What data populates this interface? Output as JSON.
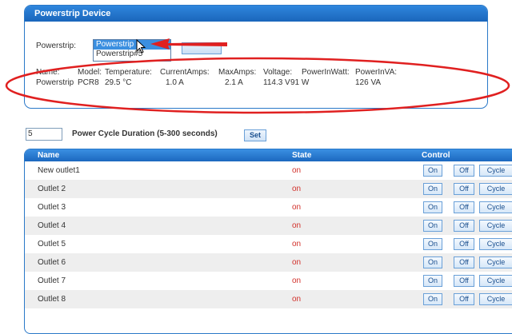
{
  "device_panel": {
    "title": "Powerstrip Device",
    "powerstrip_label": "Powerstrip:",
    "options": [
      "Powerstrip",
      "Powerstrip#5"
    ],
    "selected_option": "Powerstrip",
    "button_label": "",
    "info": {
      "headers": [
        "Name:",
        "Model:",
        "Temperature:",
        "CurrentAmps:",
        "MaxAmps:",
        "Voltage:",
        "PowerInWatt:",
        "PowerInVA:"
      ],
      "values": [
        "Powerstrip",
        "PCR8",
        "29.5 °C",
        "1.0 A",
        "2.1 A",
        "114.3 V",
        "91 W",
        "126 VA"
      ]
    }
  },
  "duration": {
    "value": "5",
    "label": "Power Cycle Duration (5-300 seconds)",
    "set_label": "Set"
  },
  "outlets_table": {
    "headers": {
      "name": "Name",
      "state": "State",
      "control": "Control"
    },
    "control_labels": {
      "on": "On",
      "off": "Off",
      "cycle": "Cycle"
    },
    "rows": [
      {
        "name": "New outlet1",
        "state": "on"
      },
      {
        "name": "Outlet 2",
        "state": "on"
      },
      {
        "name": "Outlet 3",
        "state": "on"
      },
      {
        "name": "Outlet 4",
        "state": "on"
      },
      {
        "name": "Outlet 5",
        "state": "on"
      },
      {
        "name": "Outlet 6",
        "state": "on"
      },
      {
        "name": "Outlet 7",
        "state": "on"
      },
      {
        "name": "Outlet 8",
        "state": "on"
      }
    ]
  },
  "annotation": {
    "arrow_color": "#e02020",
    "ellipse_color": "#e02020"
  }
}
